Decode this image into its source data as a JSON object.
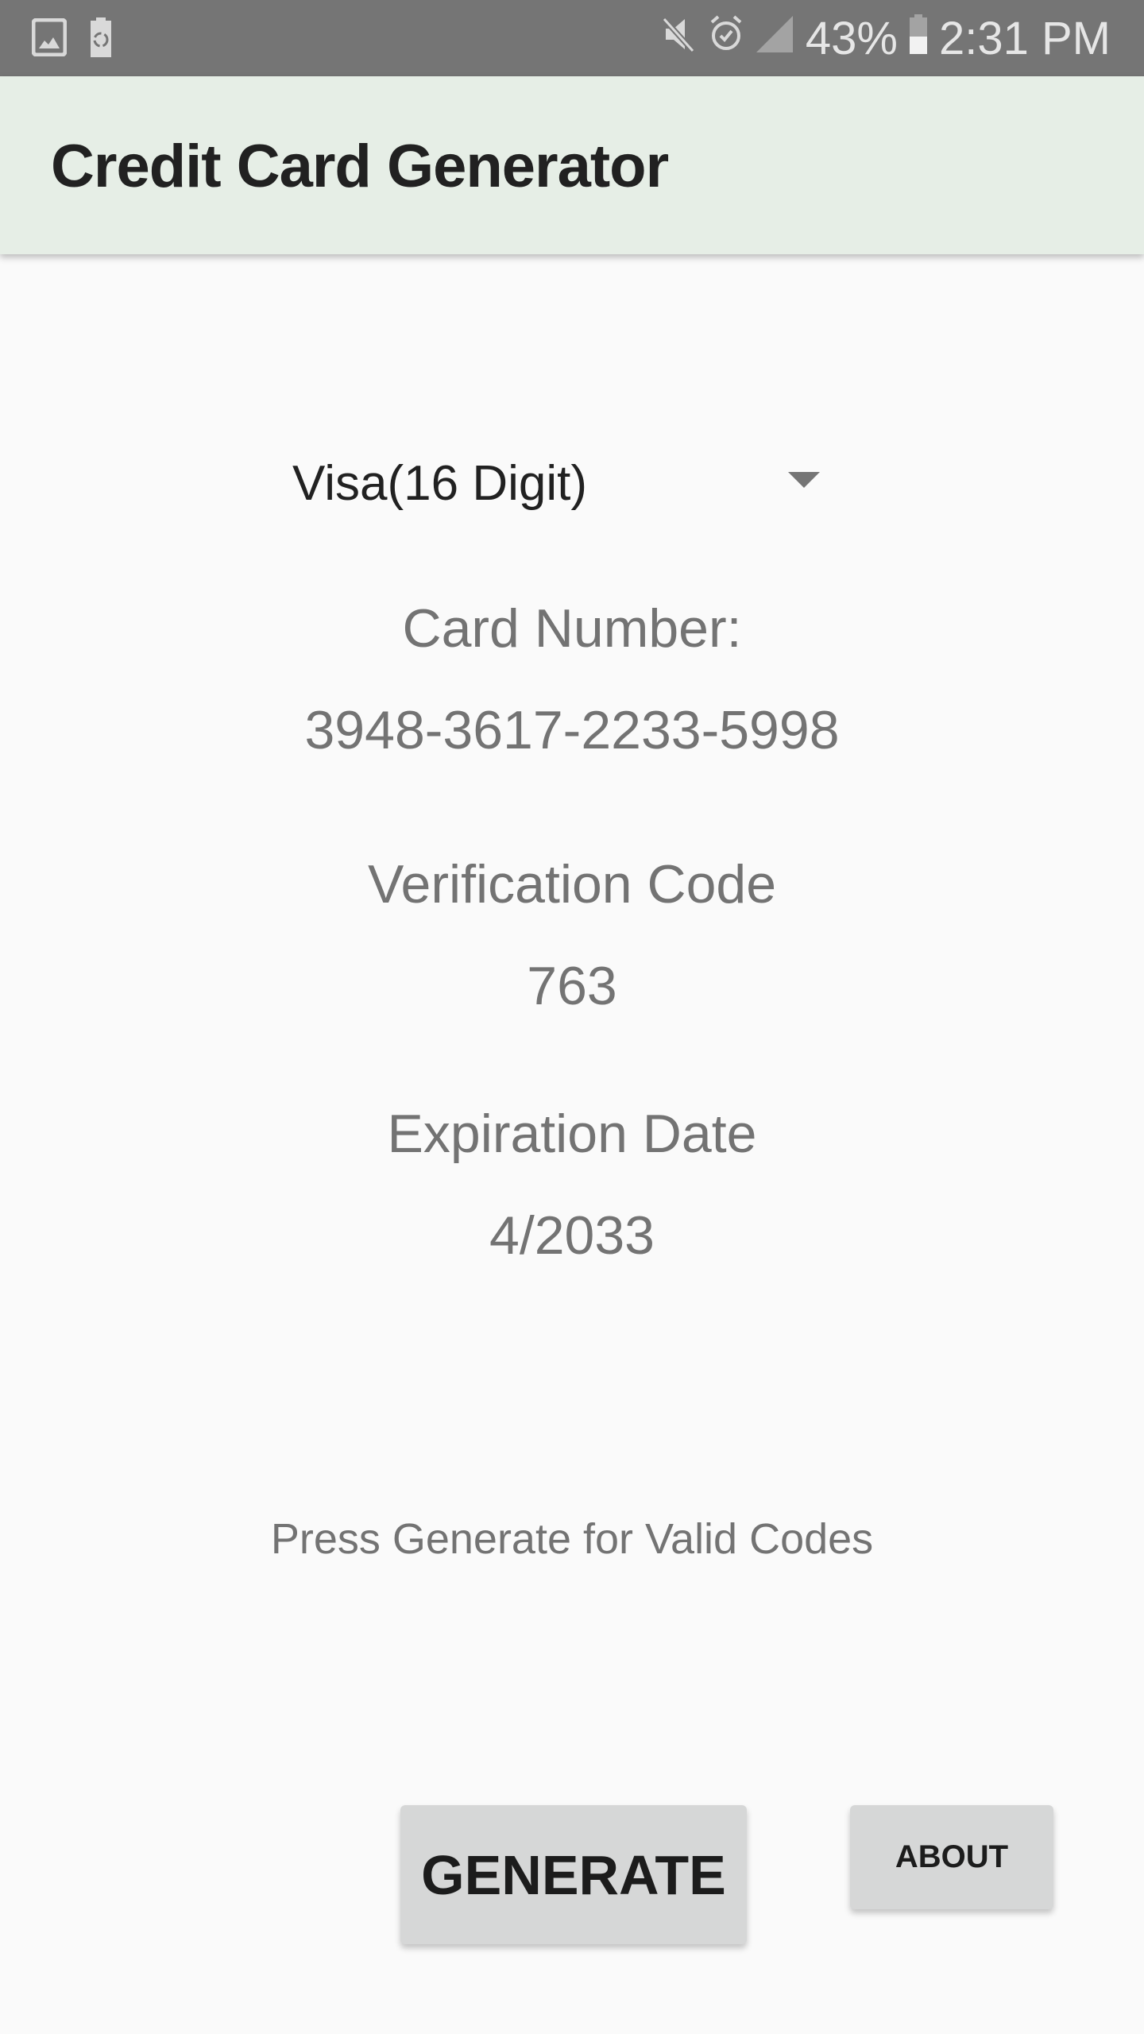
{
  "status_bar": {
    "left_icons": [
      "gallery-icon",
      "battery-saver-recycle-icon"
    ],
    "right_icons": [
      "mute-icon",
      "alarm-icon",
      "signal-icon"
    ],
    "battery_percent": "43%",
    "battery_level": 0.43,
    "time": "2:31 PM"
  },
  "app_bar": {
    "title": "Credit Card Generator"
  },
  "card_type_spinner": {
    "selected": "Visa(16 Digit)"
  },
  "card_number": {
    "label": "Card Number:",
    "value": "3948-3617-2233-5998"
  },
  "verification_code": {
    "label": "Verification Code",
    "value": "763"
  },
  "expiration_date": {
    "label": "Expiration Date",
    "value": "4/2033"
  },
  "hint": "Press Generate for Valid Codes",
  "buttons": {
    "generate": "GENERATE",
    "about": "ABOUT"
  },
  "colors": {
    "status_bar": "#757575",
    "app_bar": "#e6eee6",
    "background": "#fafafa",
    "button": "#d6d7d7",
    "secondary_text": "#737373"
  }
}
